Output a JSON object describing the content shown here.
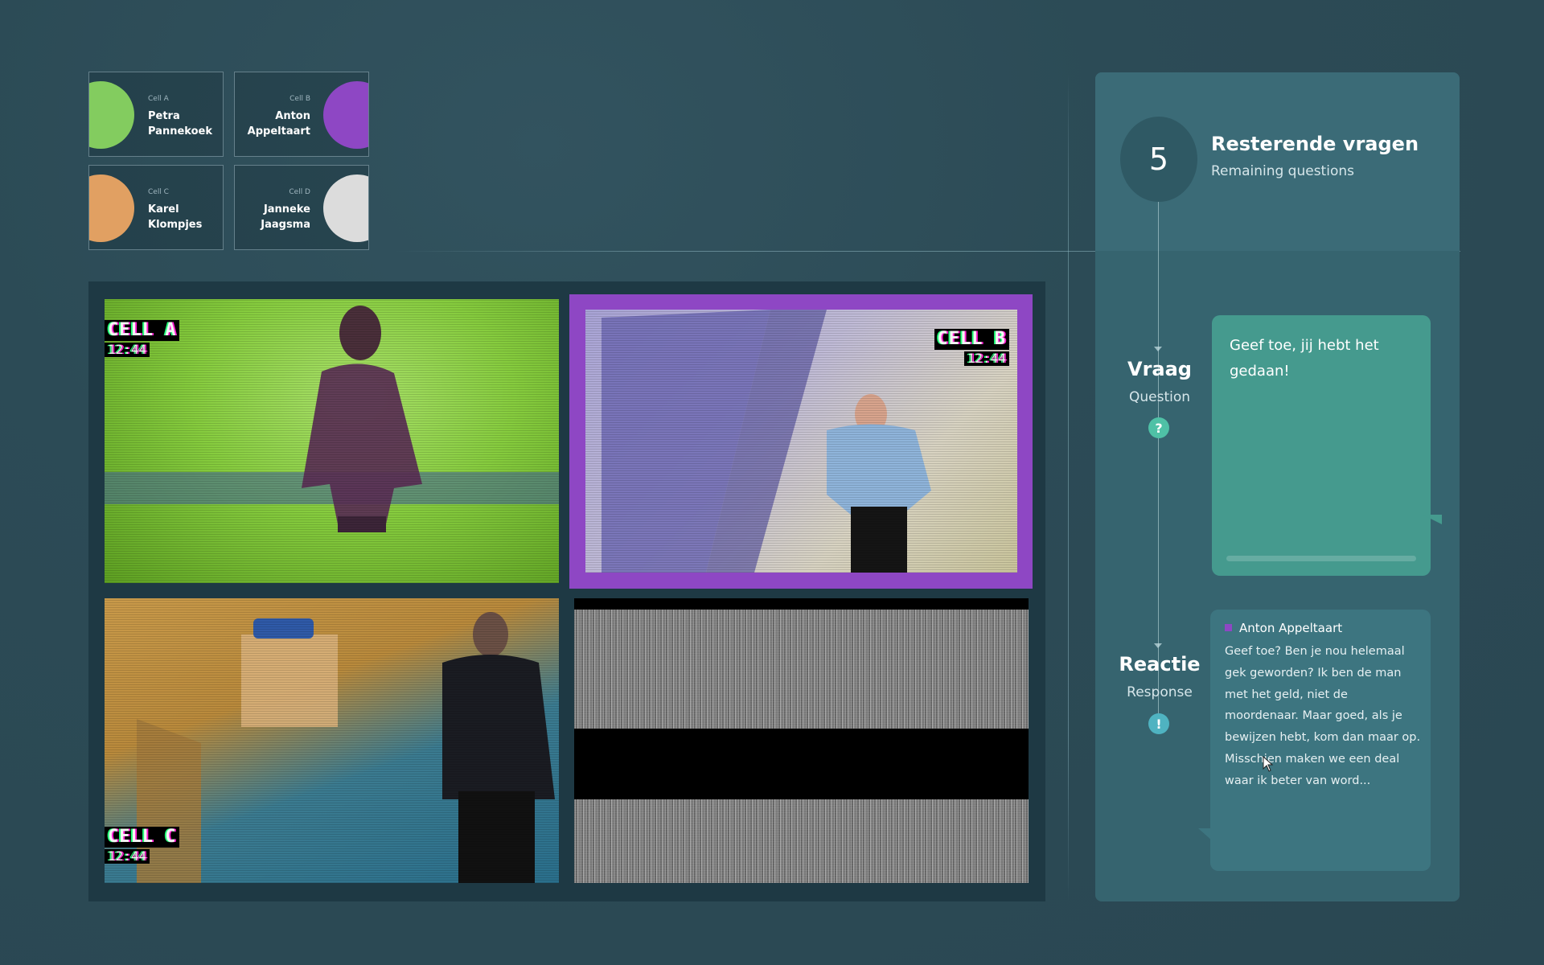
{
  "suspects": [
    {
      "cell": "Cell A",
      "name": "Petra Pannekoek",
      "color": "#83cc5f"
    },
    {
      "cell": "Cell B",
      "name": "Anton Appeltaart",
      "color": "#8e47c4"
    },
    {
      "cell": "Cell C",
      "name": "Karel Klompjes",
      "color": "#e1a062"
    },
    {
      "cell": "Cell D",
      "name": "Janneke Jaagsma",
      "color": "#dcdcdc"
    }
  ],
  "cameras": [
    {
      "label": "CELL A",
      "time": "12:44"
    },
    {
      "label": "CELL B",
      "time": "12:44"
    },
    {
      "label": "CELL C",
      "time": "12:44"
    }
  ],
  "panel": {
    "remaining_count": "5",
    "title": "Resterende vragen",
    "subtitle": "Remaining questions",
    "question": {
      "label": "Vraag",
      "sublabel": "Question",
      "icon": "?",
      "text": "Geef toe, jij hebt het gedaan!"
    },
    "response": {
      "label": "Reactie",
      "sublabel": "Response",
      "icon": "!",
      "speaker": "Anton Appeltaart",
      "text": "Geef toe? Ben je nou helemaal gek geworden? Ik ben de man met het geld, niet de moordenaar. Maar goed, als je bewijzen hebt, kom dan maar op. Misschien maken we een deal waar ik beter van word..."
    }
  },
  "colors": {
    "selected_frame": "#8e47c4",
    "question_bubble": "#459a8e",
    "question_badge": "#4fc1a6",
    "response_badge": "#4fb3c1"
  }
}
